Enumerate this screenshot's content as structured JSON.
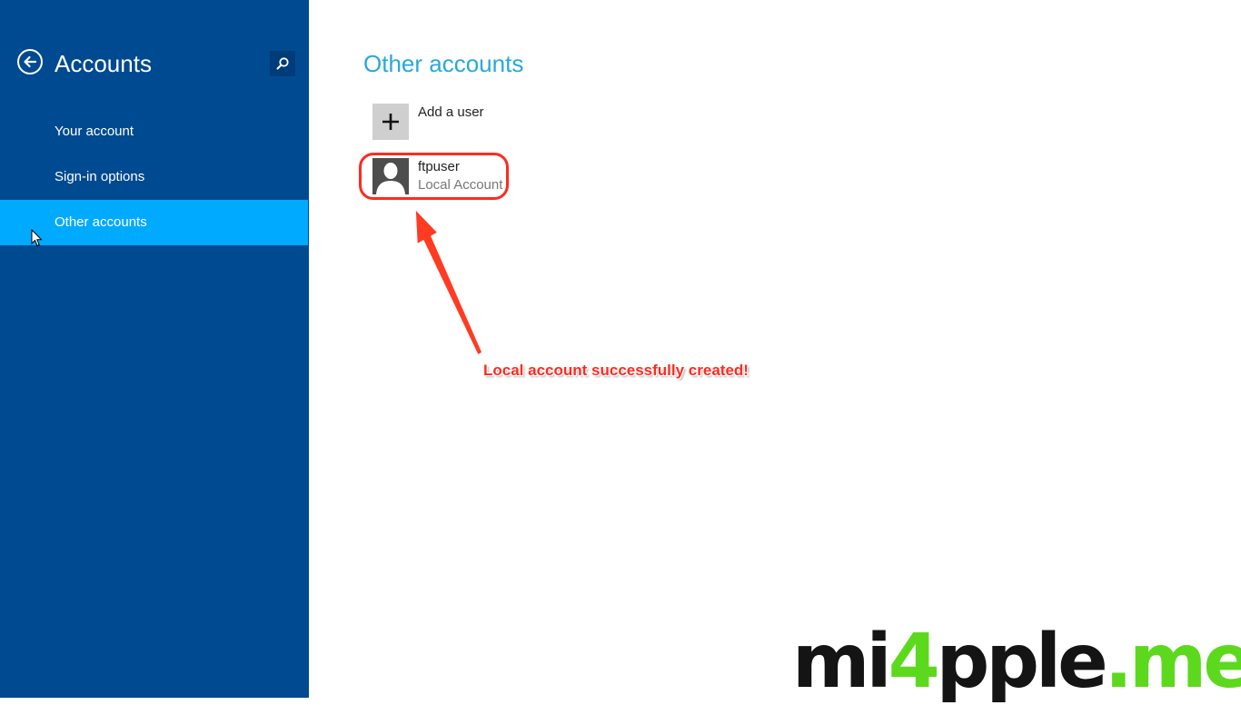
{
  "sidebar": {
    "title": "Accounts",
    "back_icon": "arrow-left-icon",
    "search_icon": "search-icon",
    "items": [
      {
        "label": "Your account",
        "selected": false
      },
      {
        "label": "Sign-in options",
        "selected": false
      },
      {
        "label": "Other accounts",
        "selected": true
      }
    ]
  },
  "main": {
    "title": "Other accounts",
    "add_user": {
      "label": "Add a user",
      "icon": "plus-icon"
    },
    "users": [
      {
        "name": "ftpuser",
        "type": "Local Account",
        "icon": "user-avatar-icon"
      }
    ]
  },
  "annotation": {
    "text": "Local account successfully created!",
    "color": "#ff2a1f"
  },
  "watermark": {
    "part1": "mi",
    "part2": "4",
    "part3": "pple",
    "part4": ".me"
  },
  "colors": {
    "sidebar_bg": "#004a91",
    "selected_bg": "#00aaff",
    "title_accent": "#27a9d9"
  }
}
